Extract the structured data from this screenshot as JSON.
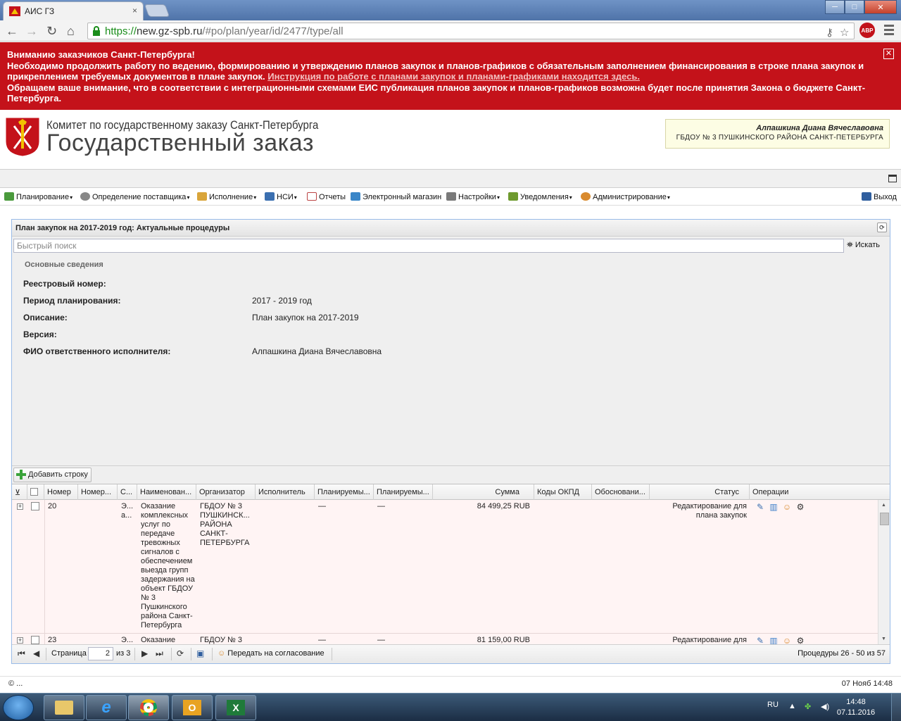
{
  "browser": {
    "tab_title": "АИС ГЗ",
    "tab_close": "×",
    "url_scheme": "https://",
    "url_host": "new.gz-spb.ru",
    "url_rest": "/#po/plan/year/id/2477/type/all",
    "abp_label": "ABP",
    "window_min": "─",
    "window_max": "□",
    "window_close": "✕"
  },
  "notice": {
    "line1": "Вниманию заказчиков Санкт-Петербурга!",
    "line2": "Необходимо продолжить работу по ведению, формированию и утверждению планов закупок и планов-графиков с обязательным заполнением финансирования в строке плана закупок и прикреплением требуемых документов в плане закупок. ",
    "link": "Инструкция по работе с планами закупок и планами-графиками находится здесь.",
    "line3": "Обращаем ваше внимание, что в соответствии с интеграционными схемами ЕИС публикация планов закупок и планов-графиков возможна будет после принятия Закона о бюджете Санкт-Петербурга.",
    "close": "✕"
  },
  "header": {
    "brand_line1": "Комитет по государственному заказу Санкт-Петербурга",
    "brand_line2": "Государственный заказ",
    "user_name": "Алпашкина Диана Вячеславовна",
    "user_org": "ГБДОУ № 3 ПУШКИНСКОГО РАЙОНА САНКТ-ПЕТЕРБУРГА"
  },
  "menu": {
    "items": [
      {
        "label": "Планирование",
        "dropdown": true
      },
      {
        "label": "Определение поставщика",
        "dropdown": true
      },
      {
        "label": "Исполнение",
        "dropdown": true
      },
      {
        "label": "НСИ",
        "dropdown": true
      },
      {
        "label": "Отчеты",
        "dropdown": false
      },
      {
        "label": "Электронный магазин",
        "dropdown": false
      },
      {
        "label": "Настройки",
        "dropdown": true
      },
      {
        "label": "Уведомления",
        "dropdown": true
      },
      {
        "label": "Администрирование",
        "dropdown": true
      }
    ],
    "exit": "Выход",
    "dd_mark": "▾"
  },
  "panel": {
    "title": "План закупок на 2017-2019 год: Актуальные процедуры",
    "search_placeholder": "Быстрый поиск",
    "search_button": "Искать",
    "fieldset_title": "Основные сведения",
    "fields": [
      {
        "label": "Реестровый номер:",
        "value": ""
      },
      {
        "label": "Период планирования:",
        "value": "2017 - 2019 год"
      },
      {
        "label": "Описание:",
        "value": "План закупок на 2017-2019"
      },
      {
        "label": "Версия:",
        "value": ""
      },
      {
        "label": "ФИО ответственного исполнителя:",
        "value": "Алпашкина Диана Вячеславовна"
      }
    ],
    "add_row": "Добавить строку"
  },
  "grid": {
    "columns": [
      "Номер",
      "Номер...",
      "С...",
      "Наименован...",
      "Организатор",
      "Исполнитель",
      "Планируемы...",
      "Планируемы...",
      "Сумма",
      "Коды ОКПД",
      "Обосновани...",
      "Статус",
      "Операции"
    ],
    "rows": [
      {
        "number": "20",
        "c": "Э... а...",
        "name": "Оказание комплексных услуг по передаче тревожных сигналов с обеспечением выезда групп задержания на объект ГБДОУ № 3 Пушкинского района Санкт-Петербурга",
        "organizer": "ГБДОУ № 3 ПУШКИНСК... РАЙОНА САНКТ-ПЕТЕРБУРГА",
        "plan1": "—",
        "plan2": "—",
        "sum": "84 499,25 RUB",
        "status": "Редактирование для плана закупок"
      },
      {
        "number": "23",
        "c": "Э...",
        "name": "Оказание",
        "organizer": "ГБДОУ № 3",
        "plan1": "—",
        "plan2": "—",
        "sum": "81 159,00 RUB",
        "status": "Редактирование для"
      }
    ]
  },
  "pager": {
    "page_label": "Страница",
    "page_value": "2",
    "of_label": "из 3",
    "send_label": "Передать на согласование",
    "summary": "Процедуры 26 - 50 из 57"
  },
  "status_bar": {
    "left": "© ...",
    "right": "07 Нояб 14:48"
  },
  "taskbar": {
    "lang": "RU",
    "time": "14:48",
    "date": "07.11.2016"
  }
}
